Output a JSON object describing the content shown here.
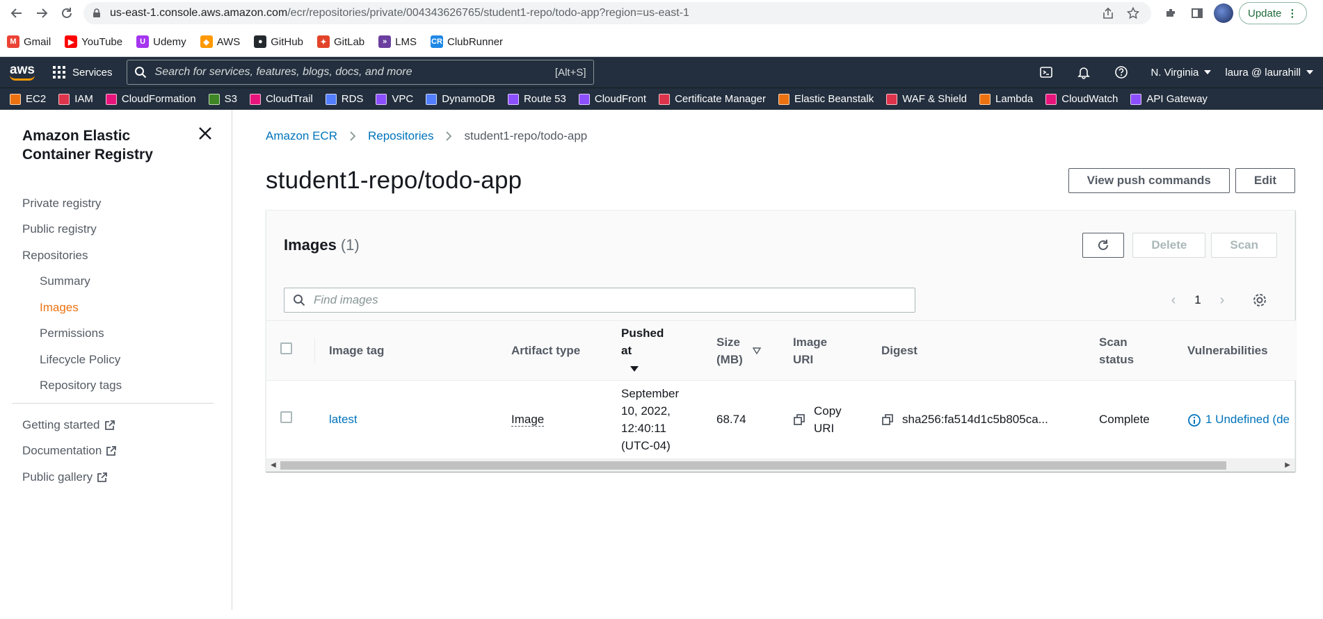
{
  "browser": {
    "url_domain": "us-east-1.console.aws.amazon.com",
    "url_path": "/ecr/repositories/private/004343626765/student1-repo/todo-app?region=us-east-1",
    "update_label": "Update",
    "bookmarks": [
      {
        "label": "Gmail",
        "color": "#ea4335",
        "glyph": "M"
      },
      {
        "label": "YouTube",
        "color": "#ff0000",
        "glyph": "▶"
      },
      {
        "label": "Udemy",
        "color": "#a435f0",
        "glyph": "U"
      },
      {
        "label": "AWS",
        "color": "#ff9900",
        "glyph": "◆"
      },
      {
        "label": "GitHub",
        "color": "#24292e",
        "glyph": "●"
      },
      {
        "label": "GitLab",
        "color": "#e24329",
        "glyph": "✦"
      },
      {
        "label": "LMS",
        "color": "#6b3fa0",
        "glyph": "»"
      },
      {
        "label": "ClubRunner",
        "color": "#1e88e5",
        "glyph": "CR"
      }
    ]
  },
  "aws_nav": {
    "logo": "aws",
    "services_label": "Services",
    "search_placeholder": "Search for services, features, blogs, docs, and more",
    "search_shortcut": "[Alt+S]",
    "region": "N. Virginia",
    "account": "laura @ laurahill"
  },
  "favorites": [
    {
      "label": "EC2",
      "color": "#ec7211"
    },
    {
      "label": "IAM",
      "color": "#dd344c"
    },
    {
      "label": "CloudFormation",
      "color": "#e7157b"
    },
    {
      "label": "S3",
      "color": "#3f8624"
    },
    {
      "label": "CloudTrail",
      "color": "#e7157b"
    },
    {
      "label": "RDS",
      "color": "#527fff"
    },
    {
      "label": "VPC",
      "color": "#8c4fff"
    },
    {
      "label": "DynamoDB",
      "color": "#527fff"
    },
    {
      "label": "Route 53",
      "color": "#8c4fff"
    },
    {
      "label": "CloudFront",
      "color": "#8c4fff"
    },
    {
      "label": "Certificate Manager",
      "color": "#dd344c"
    },
    {
      "label": "Elastic Beanstalk",
      "color": "#ec7211"
    },
    {
      "label": "WAF & Shield",
      "color": "#dd344c"
    },
    {
      "label": "Lambda",
      "color": "#ec7211"
    },
    {
      "label": "CloudWatch",
      "color": "#e7157b"
    },
    {
      "label": "API Gateway",
      "color": "#8c4fff"
    }
  ],
  "sidebar": {
    "title": "Amazon Elastic Container Registry",
    "items": [
      {
        "label": "Private registry"
      },
      {
        "label": "Public registry"
      },
      {
        "label": "Repositories"
      },
      {
        "label": "Summary"
      },
      {
        "label": "Images"
      },
      {
        "label": "Permissions"
      },
      {
        "label": "Lifecycle Policy"
      },
      {
        "label": "Repository tags"
      }
    ],
    "links": [
      {
        "label": "Getting started"
      },
      {
        "label": "Documentation"
      },
      {
        "label": "Public gallery"
      }
    ]
  },
  "breadcrumb": [
    "Amazon ECR",
    "Repositories",
    "student1-repo/todo-app"
  ],
  "page": {
    "title": "student1-repo/todo-app",
    "view_push_label": "View push commands",
    "edit_label": "Edit"
  },
  "images_panel": {
    "title": "Images",
    "count": "(1)",
    "delete_label": "Delete",
    "scan_label": "Scan",
    "filter_placeholder": "Find images",
    "page": "1",
    "columns": [
      "Image tag",
      "Artifact type",
      "Pushed at",
      "Size (MB)",
      "Image URI",
      "Digest",
      "Scan status",
      "Vulnerabilities"
    ],
    "rows": [
      {
        "tag": "latest",
        "artifact": "Image",
        "pushed": "September 10, 2022, 12:40:11 (UTC-04)",
        "size": "68.74",
        "uri": "Copy URI",
        "digest": "sha256:fa514d1c5b805ca...",
        "scan_status": "Complete",
        "vulns": "1 Undefined",
        "vulns_cut": "(de"
      }
    ]
  },
  "colors": {
    "aws_nav_bg": "#232f3e",
    "link": "#0073bb",
    "active": "#ec7211"
  }
}
